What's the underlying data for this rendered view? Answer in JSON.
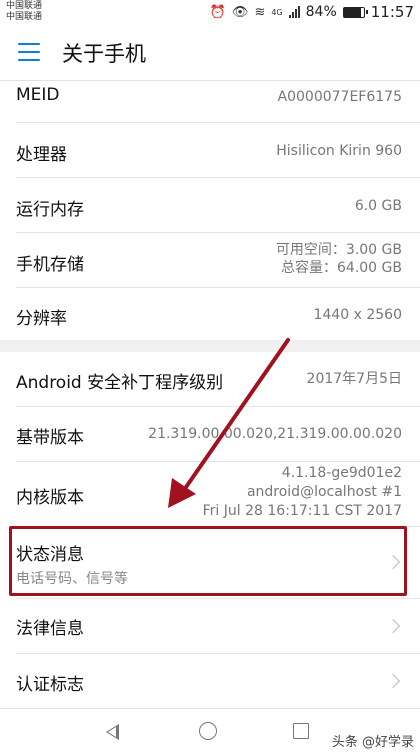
{
  "status_bar": {
    "carrier_1": "中国联通",
    "carrier_2": "中国联通",
    "network": "4G",
    "battery": "84%",
    "battery_level": 0.84,
    "time": "11:57",
    "icons": [
      "alarm-icon",
      "eye-icon",
      "wifi-icon",
      "signal-icon",
      "battery-icon"
    ]
  },
  "app_bar": {
    "title": "关于手机",
    "menu_icon": "hamburger-menu-icon",
    "accent": "#0a7fd6"
  },
  "section1": [
    {
      "label": "MEID",
      "value": "A0000077EF6175"
    },
    {
      "label": "处理器",
      "value": "Hisilicon Kirin 960"
    },
    {
      "label": "运行内存",
      "value": "6.0 GB"
    },
    {
      "label": "手机存储",
      "value_line1": "可用空间：3.00 GB",
      "value_line2": "总容量：64.00 GB"
    },
    {
      "label": "分辨率",
      "value": "1440 x 2560"
    }
  ],
  "section2": {
    "security_patch": {
      "label": "Android 安全补丁程序级别",
      "value": "2017年7月5日"
    },
    "baseband": {
      "label": "基带版本",
      "value": "21.319.00.00.020,21.319.00.00.020"
    },
    "kernel": {
      "label": "内核版本",
      "line1": "4.1.18-ge9d01e2",
      "line2": "android@localhost #1",
      "line3": "Fri Jul 28 16:17:11 CST 2017"
    },
    "status": {
      "label": "状态消息",
      "sublabel": "电话号码、信号等"
    },
    "legal": {
      "label": "法律信息"
    },
    "certification": {
      "label": "认证标志"
    }
  },
  "annotation": {
    "color": "#a2111e"
  },
  "nav_bar": {
    "icons": [
      "back-icon",
      "home-icon",
      "recent-apps-icon"
    ],
    "watermark": "头条 @好学录"
  }
}
